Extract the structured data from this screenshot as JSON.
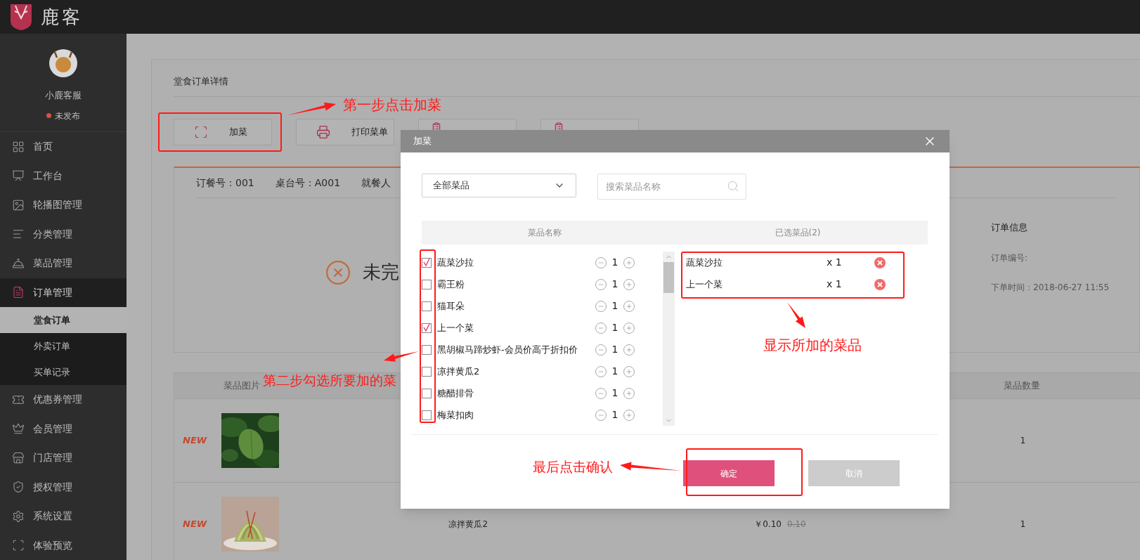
{
  "app": {
    "logo_text": "鹿客"
  },
  "sidebar": {
    "user": {
      "name": "小鹿客服",
      "status": "未发布"
    },
    "items": [
      {
        "label": "首页",
        "selected": false
      },
      {
        "label": "工作台",
        "selected": false
      },
      {
        "label": "轮播图管理",
        "selected": false
      },
      {
        "label": "分类管理",
        "selected": false
      },
      {
        "label": "菜品管理",
        "selected": false
      },
      {
        "label": "订单管理",
        "selected": true,
        "expanded": true,
        "children": [
          {
            "label": "堂食订单",
            "selected": true
          },
          {
            "label": "外卖订单",
            "selected": false
          },
          {
            "label": "买单记录",
            "selected": false
          }
        ]
      },
      {
        "label": "优惠券管理",
        "selected": false
      },
      {
        "label": "会员管理",
        "selected": false
      },
      {
        "label": "门店管理",
        "selected": false
      },
      {
        "label": "授权管理",
        "selected": false
      },
      {
        "label": "系统设置",
        "selected": false
      },
      {
        "label": "体验预览",
        "selected": false
      }
    ]
  },
  "page": {
    "title": "堂食订单详情",
    "actions": [
      {
        "label": "加菜"
      },
      {
        "label": "打印菜单"
      }
    ],
    "order": {
      "fields": [
        "订餐号：001",
        "桌台号：A001",
        "就餐人"
      ],
      "status": "未完",
      "info": {
        "title": "订单信息",
        "lines": [
          "订单编号:",
          "下单时间：2018-06-27 11:55"
        ]
      }
    },
    "table": {
      "columns": [
        "菜品图片",
        "菜品数量"
      ],
      "rows": [
        {
          "badge": "NEW",
          "quantity": "1"
        },
        {
          "badge": "NEW",
          "name": "凉拌黄瓜2",
          "price": "￥0.10",
          "original_price": "0.10",
          "quantity": "1"
        }
      ]
    }
  },
  "dialog": {
    "title": "加菜",
    "category": {
      "value": "全部菜品"
    },
    "search": {
      "placeholder": "搜索菜品名称"
    },
    "columns": [
      "菜品名称",
      "已选菜品(2)"
    ],
    "dishes": [
      {
        "name": "蔬菜沙拉",
        "checked": true,
        "quantity": "1"
      },
      {
        "name": "霸王粉",
        "checked": false,
        "quantity": "1"
      },
      {
        "name": "猫耳朵",
        "checked": false,
        "quantity": "1"
      },
      {
        "name": "上一个菜",
        "checked": true,
        "quantity": "1"
      },
      {
        "name": "黑胡椒马蹄炒虾-会员价高于折扣价",
        "checked": false,
        "quantity": "1"
      },
      {
        "name": "凉拌黄瓜2",
        "checked": false,
        "quantity": "1"
      },
      {
        "name": "糖醋排骨",
        "checked": false,
        "quantity": "1"
      },
      {
        "name": "梅菜扣肉",
        "checked": false,
        "quantity": "1"
      }
    ],
    "selected": [
      {
        "name": "蔬菜沙拉",
        "quantity": "x 1"
      },
      {
        "name": "上一个菜",
        "quantity": "x 1"
      }
    ],
    "buttons": [
      {
        "label": "确定",
        "kind": "primary"
      },
      {
        "label": "取消",
        "kind": "secondary"
      }
    ]
  },
  "annotations": [
    "第一步点击加菜",
    "第二步勾选所要加的菜",
    "显示所加的菜品",
    "最后点击确认"
  ]
}
